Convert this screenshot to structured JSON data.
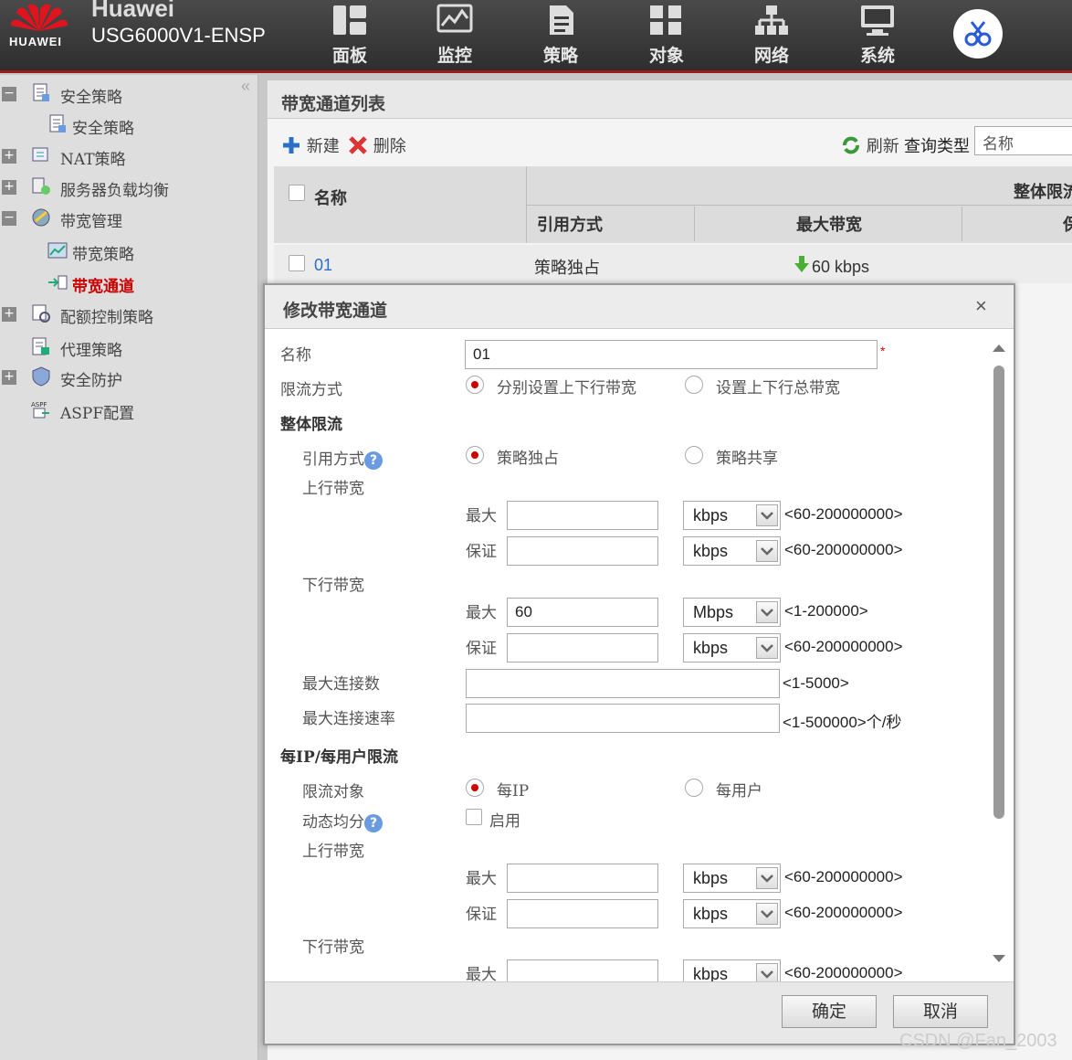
{
  "header": {
    "brand": "Huawei",
    "logo_text": "HUAWEI",
    "model": "USG6000V1-ENSP",
    "nav": [
      {
        "label": "面板",
        "icon": "dashboard-icon"
      },
      {
        "label": "监控",
        "icon": "monitor-icon"
      },
      {
        "label": "策略",
        "icon": "policy-icon"
      },
      {
        "label": "对象",
        "icon": "object-icon"
      },
      {
        "label": "网络",
        "icon": "network-icon"
      },
      {
        "label": "系统",
        "icon": "system-icon"
      }
    ],
    "special_icon": "scissors-icon"
  },
  "sidebar": {
    "items": [
      {
        "label": "安全策略",
        "expander": "−",
        "icon": "policy-doc-icon"
      },
      {
        "label": "安全策略",
        "icon": "policy-doc-icon"
      },
      {
        "label": "NAT策略",
        "expander": "+",
        "icon": "nat-icon"
      },
      {
        "label": "服务器负载均衡",
        "expander": "+",
        "icon": "server-lb-icon"
      },
      {
        "label": "带宽管理",
        "expander": "−",
        "icon": "bandwidth-icon"
      },
      {
        "label": "带宽策略",
        "icon": "bandwidth-policy-icon"
      },
      {
        "label": "带宽通道",
        "icon": "bandwidth-channel-icon",
        "active": true
      },
      {
        "label": "配额控制策略",
        "expander": "+",
        "icon": "quota-icon"
      },
      {
        "label": "代理策略",
        "icon": "proxy-icon"
      },
      {
        "label": "安全防护",
        "expander": "+",
        "icon": "shield-icon"
      },
      {
        "label": "ASPF配置",
        "icon": "aspf-icon"
      }
    ]
  },
  "main": {
    "title": "带宽通道列表",
    "toolbar": {
      "new": "新建",
      "delete": "删除",
      "refresh": "刷新",
      "query_type": "查询类型",
      "query_value": "名称"
    },
    "table": {
      "headers": {
        "name": "名称",
        "group_overall": "整体限流",
        "ref_mode": "引用方式",
        "max_bw": "最大带宽",
        "guarantee": "保"
      },
      "rows": [
        {
          "name": "01",
          "ref_mode": "策略独占",
          "max_bw": "60 kbps"
        }
      ]
    }
  },
  "dialog": {
    "title": "修改带宽通道",
    "close": "×",
    "name_label": "名称",
    "name_value": "01",
    "required_mark": "*",
    "limit_mode_label": "限流方式",
    "limit_mode_options": [
      "分别设置上下行带宽",
      "设置上下行总带宽"
    ],
    "overall_section": "整体限流",
    "ref_mode_label": "引用方式",
    "ref_mode_options": [
      "策略独占",
      "策略共享"
    ],
    "upstream_label": "上行带宽",
    "downstream_label": "下行带宽",
    "max_label": "最大",
    "guarantee_label": "保证",
    "up_max": {
      "value": "",
      "unit": "kbps",
      "range": "<60-200000000>"
    },
    "up_guarantee": {
      "value": "",
      "unit": "kbps",
      "range": "<60-200000000>"
    },
    "down_max": {
      "value": "60",
      "unit": "Mbps",
      "range": "<1-200000>"
    },
    "down_guarantee": {
      "value": "",
      "unit": "kbps",
      "range": "<60-200000000>"
    },
    "max_conn_label": "最大连接数",
    "max_conn_range": "<1-5000>",
    "max_conn_rate_label": "最大连接速率",
    "max_conn_rate_range": "<1-500000>个/秒",
    "perip_section": "每IP/每用户限流",
    "limit_target_label": "限流对象",
    "limit_target_options": [
      "每IP",
      "每用户"
    ],
    "dynamic_label": "动态均分",
    "enable_label": "启用",
    "p_up_max": {
      "value": "",
      "unit": "kbps",
      "range": "<60-200000000>"
    },
    "p_up_guarantee": {
      "value": "",
      "unit": "kbps",
      "range": "<60-200000000>"
    },
    "p_down_max": {
      "value": "",
      "unit": "kbps",
      "range": "<60-200000000>"
    },
    "ok": "确定",
    "cancel": "取消"
  },
  "watermark": "CSDN @Fan_2003"
}
